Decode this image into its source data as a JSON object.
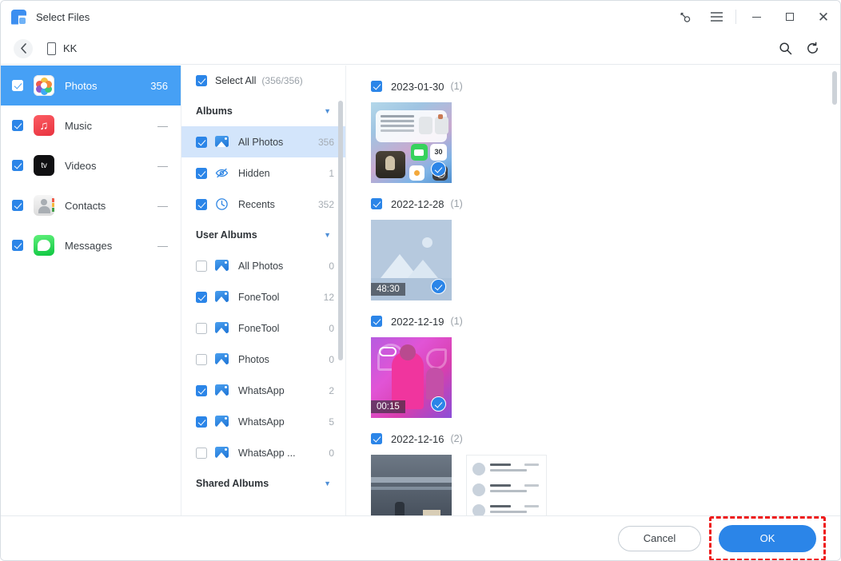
{
  "window": {
    "title": "Select Files",
    "logo_icon": "fonetool-logo-icon",
    "controls": {
      "key_icon": "key-icon",
      "menu_icon": "hamburger-menu-icon",
      "minimize_icon": "minimize-icon",
      "maximize_icon": "maximize-icon",
      "close_icon": "close-icon"
    }
  },
  "navbar": {
    "back_icon": "chevron-left-icon",
    "device_icon": "phone-icon",
    "device_name": "KK",
    "search_icon": "search-icon",
    "refresh_icon": "refresh-icon"
  },
  "sidebar": {
    "items": [
      {
        "label": "Photos",
        "count": "356",
        "checked": true,
        "selected": true,
        "icon": "photos-app-icon"
      },
      {
        "label": "Music",
        "count": "—",
        "checked": true,
        "selected": false,
        "icon": "music-app-icon"
      },
      {
        "label": "Videos",
        "count": "—",
        "checked": true,
        "selected": false,
        "icon": "appletv-app-icon"
      },
      {
        "label": "Contacts",
        "count": "—",
        "checked": true,
        "selected": false,
        "icon": "contacts-app-icon"
      },
      {
        "label": "Messages",
        "count": "—",
        "checked": true,
        "selected": false,
        "icon": "messages-app-icon"
      }
    ]
  },
  "albums_panel": {
    "select_all": {
      "label": "Select All",
      "fraction": "(356/356)",
      "checked": true
    },
    "sections": [
      {
        "title": "Albums",
        "caret_icon": "chevron-down-icon",
        "rows": [
          {
            "name": "All Photos",
            "count": "356",
            "checked": true,
            "selected": true,
            "icon": "photo-album-icon"
          },
          {
            "name": "Hidden",
            "count": "1",
            "checked": true,
            "selected": false,
            "icon": "eye-off-icon"
          },
          {
            "name": "Recents",
            "count": "352",
            "checked": true,
            "selected": false,
            "icon": "clock-icon"
          }
        ]
      },
      {
        "title": "User Albums",
        "caret_icon": "chevron-down-icon",
        "rows": [
          {
            "name": "All Photos",
            "count": "0",
            "checked": false,
            "selected": false,
            "icon": "photo-album-icon"
          },
          {
            "name": "FoneTool",
            "count": "12",
            "checked": true,
            "selected": false,
            "icon": "photo-album-icon"
          },
          {
            "name": "FoneTool",
            "count": "0",
            "checked": false,
            "selected": false,
            "icon": "photo-album-icon"
          },
          {
            "name": "Photos",
            "count": "0",
            "checked": false,
            "selected": false,
            "icon": "photo-album-icon"
          },
          {
            "name": "WhatsApp",
            "count": "2",
            "checked": true,
            "selected": false,
            "icon": "photo-album-icon"
          },
          {
            "name": "WhatsApp",
            "count": "5",
            "checked": true,
            "selected": false,
            "icon": "photo-album-icon"
          },
          {
            "name": "WhatsApp ...",
            "count": "0",
            "checked": false,
            "selected": false,
            "icon": "photo-album-icon"
          }
        ]
      },
      {
        "title": "Shared Albums",
        "caret_icon": "chevron-down-icon",
        "rows": []
      }
    ]
  },
  "photo_grid": {
    "groups": [
      {
        "date": "2023-01-30",
        "count": "(1)",
        "checked": true,
        "thumbs": [
          {
            "kind": "ios-home-screen",
            "duration": "",
            "selected": true,
            "calendar_day": "30"
          }
        ]
      },
      {
        "date": "2022-12-28",
        "count": "(1)",
        "checked": true,
        "thumbs": [
          {
            "kind": "placeholder-image",
            "duration": "48:30",
            "selected": true
          }
        ]
      },
      {
        "date": "2022-12-19",
        "count": "(1)",
        "checked": true,
        "thumbs": [
          {
            "kind": "pink-performance",
            "duration": "00:15",
            "selected": true
          }
        ]
      },
      {
        "date": "2022-12-16",
        "count": "(2)",
        "checked": true,
        "thumbs": [
          {
            "kind": "dark-street",
            "duration": "",
            "selected": false
          },
          {
            "kind": "message-list",
            "duration": "",
            "selected": false
          }
        ]
      }
    ]
  },
  "footer": {
    "cancel_label": "Cancel",
    "ok_label": "OK"
  },
  "colors": {
    "accent": "#2b85e8",
    "sidebar_selected": "#46a0f5",
    "album_selected": "#d3e5fb",
    "highlight_box": "#ee1b1b"
  }
}
